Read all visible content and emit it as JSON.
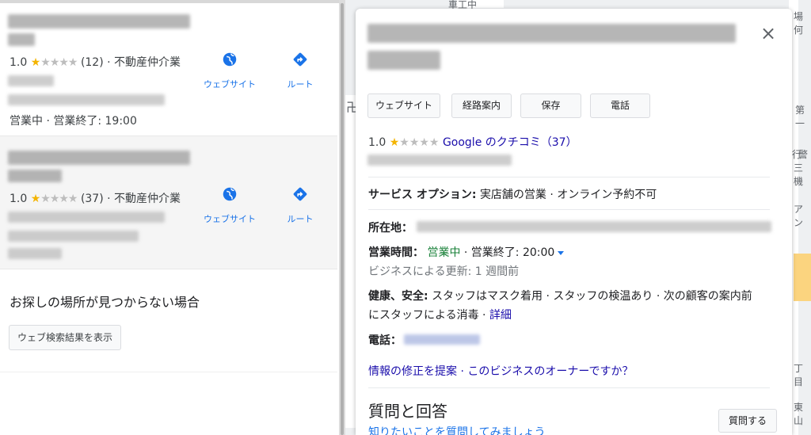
{
  "results": [
    {
      "rating": "1.0",
      "stars_filled": 1,
      "stars_total": 5,
      "review_count": "(12)",
      "category": "· 不動産仲介業",
      "status": "営業中 · 営業終了: 19:00",
      "website_label": "ウェブサイト",
      "route_label": "ルート"
    },
    {
      "rating": "1.0",
      "stars_filled": 1,
      "stars_total": 5,
      "review_count": "(37)",
      "category": "· 不動産仲介業",
      "status": "",
      "website_label": "ウェブサイト",
      "route_label": "ルート"
    }
  ],
  "not_found_text": "お探しの場所が見つからない場合",
  "web_search_button": "ウェブ検索結果を表示",
  "map_labels": {
    "a": "第一",
    "b": "行",
    "c": "警",
    "d": "三機",
    "e": "アン",
    "f": "丁目",
    "g": "東山",
    "h": "場何",
    "i": "卍"
  },
  "detail": {
    "buttons": {
      "website": "ウェブサイト",
      "directions": "経路案内",
      "save": "保存",
      "phone": "電話"
    },
    "rating": "1.0",
    "stars_filled": 1,
    "stars_total": 5,
    "reviews_link": "Google のクチコミ（37）",
    "service_label": "サービス オプション:",
    "service_value": "実店舗の営業 · オンライン予約不可",
    "address_label": "所在地：",
    "hours_label": "営業時間：",
    "hours_open": "営業中",
    "hours_close": "· 営業終了: 20:00",
    "hours_update": "ビジネスによる更新: 1 週間前",
    "health_label": "健康、安全:",
    "health_value_line1": "スタッフはマスク着用 · スタッフの検温あり · 次の顧客の案内前",
    "health_value_line2": "にスタッフによる消毒 ·",
    "health_more": "詳細",
    "phone_label": "電話：",
    "suggest_edit": "情報の修正を提案",
    "owner_question": "· このビジネスのオーナーですか？",
    "qa_title": "質問と回答",
    "qa_button": "質問する",
    "qa_link": "知りたいことを質問してみましょう"
  },
  "colors": {
    "link_blue": "#1a73e8",
    "star_yellow": "#f4b400",
    "open_green": "#188038"
  }
}
